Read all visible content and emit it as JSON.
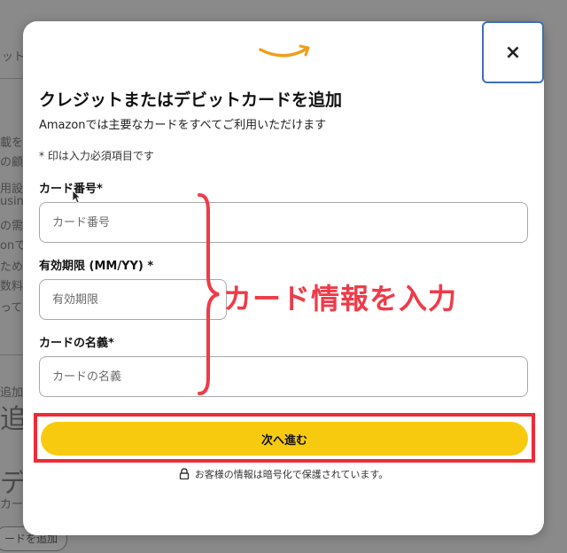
{
  "background": {
    "fragments": [
      "ットン",
      "載を",
      "の顧",
      "用設",
      "usin",
      "の需",
      "onで",
      "ため",
      "数料",
      "って",
      "を追",
      "ッしん",
      "追加",
      "デ",
      "カー"
    ],
    "big_text_1": "追",
    "big_text_2": "デ",
    "pill_label": "ードを追加"
  },
  "modal": {
    "close_label": "×",
    "title": "クレジットまたはデビットカードを追加",
    "subtitle": "Amazonでは主要なカードをすべてご利用いただけます",
    "required_note": "* 印は入力必須項目です",
    "fields": {
      "card_number": {
        "label": "カード番号*",
        "placeholder": "カード番号"
      },
      "expiry": {
        "label": "有効期限 (MM/YY) *",
        "placeholder": "有効期限"
      },
      "name": {
        "label": "カードの名義*",
        "placeholder": "カードの名義"
      }
    },
    "next_button": "次へ進む",
    "secure_note": "お客様の情報は暗号化で保護されています。"
  },
  "annotation": {
    "text": "カード情報を入力",
    "color": "#ef3b48"
  },
  "colors": {
    "accent_button": "#f7ca0f",
    "close_border": "#3f6fb5",
    "logo": "#f19e1c",
    "highlight": "#ef2b36"
  },
  "icons": [
    "amazon-smile-logo",
    "close-icon",
    "lock-icon",
    "cursor-icon"
  ]
}
